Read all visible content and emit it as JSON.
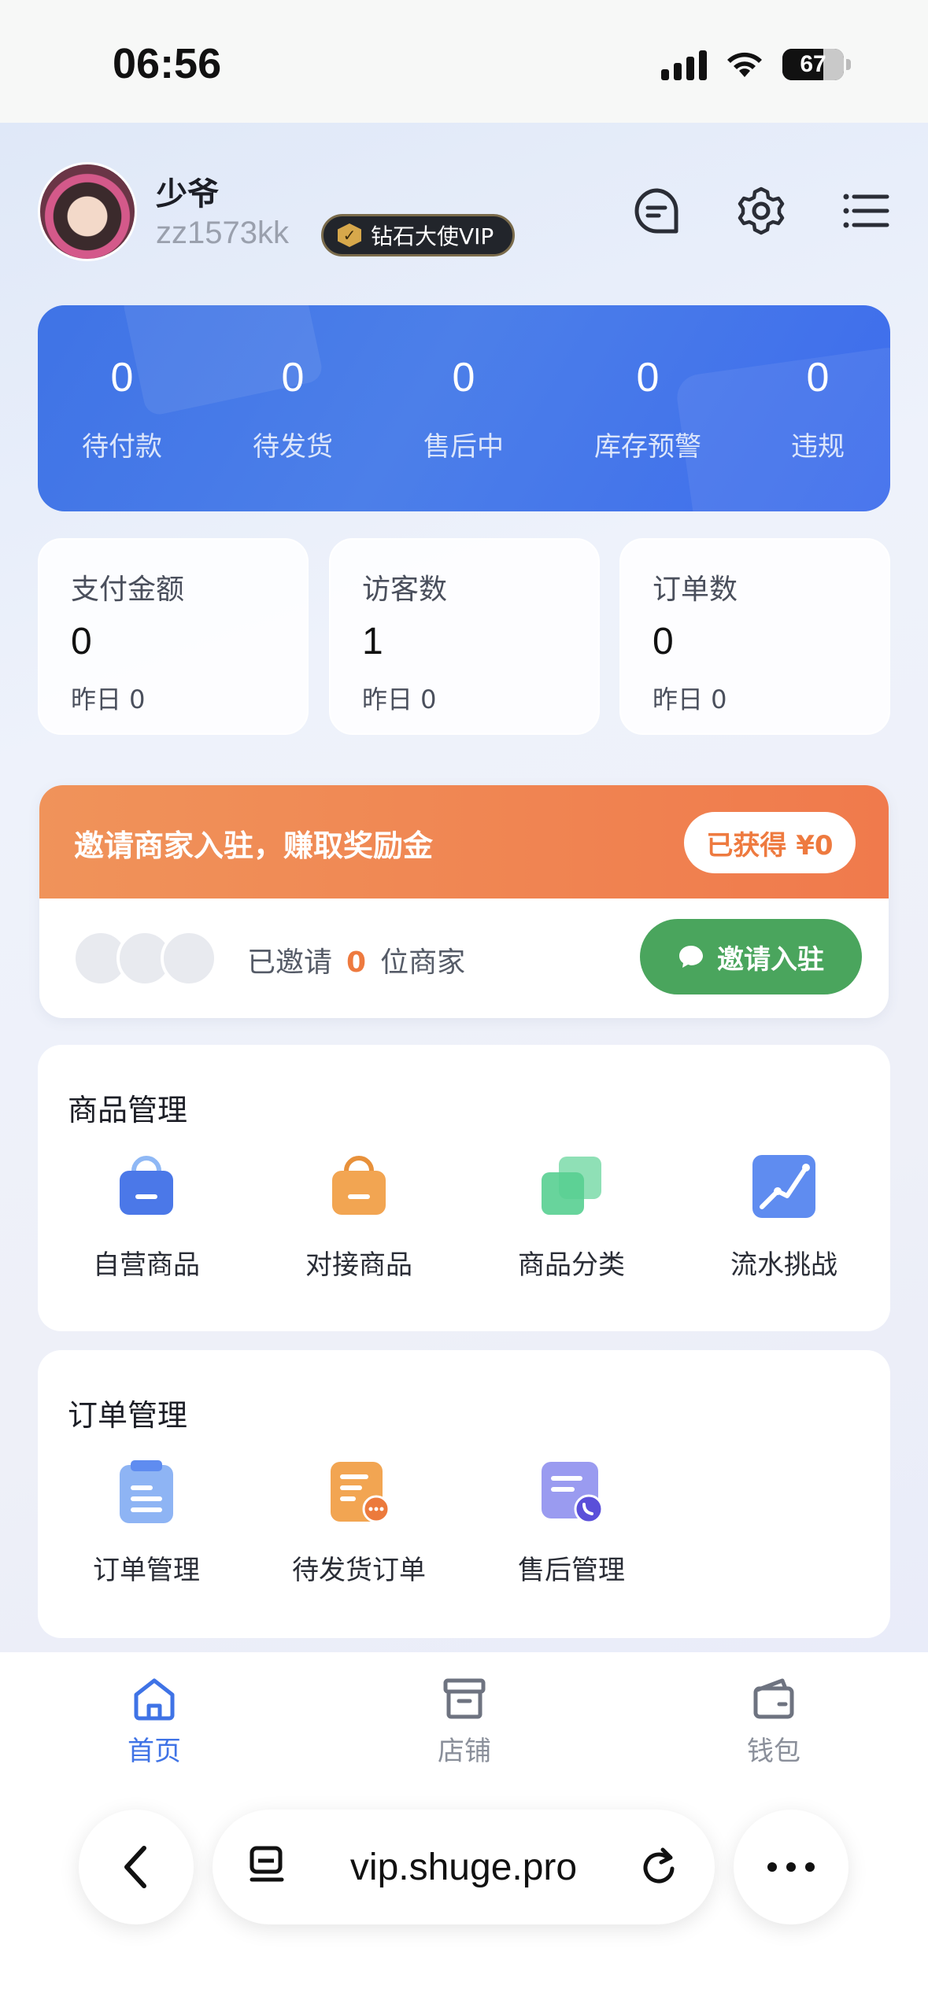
{
  "status_bar": {
    "time": "06:56",
    "battery": "67"
  },
  "profile": {
    "name": "少爷",
    "user_id": "zz1573kk",
    "vip_label": "钻石大使VIP"
  },
  "order_status": [
    {
      "value": "0",
      "label": "待付款"
    },
    {
      "value": "0",
      "label": "待发货"
    },
    {
      "value": "0",
      "label": "售后中"
    },
    {
      "value": "0",
      "label": "库存预警"
    },
    {
      "value": "0",
      "label": "违规"
    }
  ],
  "metrics": [
    {
      "label": "支付金额",
      "value": "0",
      "yesterday": "昨日 0"
    },
    {
      "label": "访客数",
      "value": "1",
      "yesterday": "昨日 0"
    },
    {
      "label": "订单数",
      "value": "0",
      "yesterday": "昨日 0"
    }
  ],
  "invite": {
    "title": "邀请商家入驻，赚取奖励金",
    "earned": "已获得 ¥0",
    "invited_prefix": "已邀请",
    "invited_count": "0",
    "invited_suffix": "位商家",
    "button": "邀请入驻"
  },
  "product_section": {
    "title": "商品管理",
    "items": [
      {
        "label": "自营商品",
        "icon": "shopping-bag-blue-icon"
      },
      {
        "label": "对接商品",
        "icon": "shopping-bag-orange-icon"
      },
      {
        "label": "商品分类",
        "icon": "category-squares-icon"
      },
      {
        "label": "流水挑战",
        "icon": "trend-line-icon"
      }
    ]
  },
  "order_section": {
    "title": "订单管理",
    "items": [
      {
        "label": "订单管理",
        "icon": "clipboard-icon"
      },
      {
        "label": "待发货订单",
        "icon": "pending-order-icon"
      },
      {
        "label": "售后管理",
        "icon": "after-sales-icon"
      }
    ]
  },
  "tabbar": [
    {
      "label": "首页",
      "icon": "home-icon",
      "active": true
    },
    {
      "label": "店铺",
      "icon": "store-icon",
      "active": false
    },
    {
      "label": "钱包",
      "icon": "wallet-icon",
      "active": false
    }
  ],
  "browser": {
    "url": "vip.shuge.pro"
  },
  "colors": {
    "primary_blue": "#3f73e6",
    "invite_orange": "#f07a4c",
    "invite_green": "#4aa55d",
    "page_bg": "#eef2fb"
  }
}
